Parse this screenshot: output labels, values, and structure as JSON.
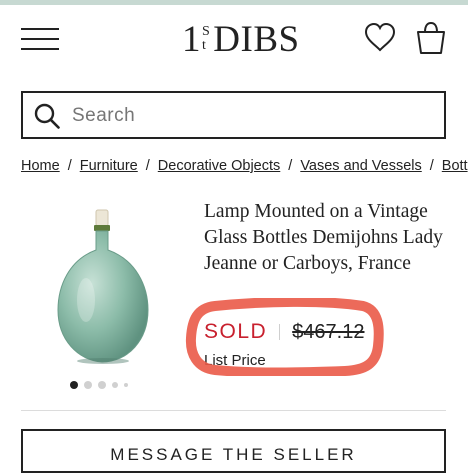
{
  "header": {
    "logo_one": "1",
    "logo_st_top": "S",
    "logo_st_bottom": "t",
    "logo_dibs": "DIBS"
  },
  "search": {
    "placeholder": "Search"
  },
  "breadcrumb": [
    "Home",
    "Furniture",
    "Decorative Objects",
    "Vases and Vessels",
    "Bott"
  ],
  "breadcrumb_separator": "/",
  "product": {
    "title": "Lamp Mounted on a Vintage Glass Bottles Demijohns Lady Jeanne or Carboys, France",
    "status": "SOLD",
    "price": "$467.12",
    "price_label": "List Price"
  },
  "gallery": {
    "image_count": 5,
    "active_index": 0
  },
  "actions": {
    "message_seller": "MESSAGE THE SELLER"
  },
  "colors": {
    "sold_red": "#c8202e",
    "highlight": "#ea5a48",
    "top_strip": "#c7d9d2",
    "glass": "#86b7a5"
  },
  "icons": [
    "menu-icon",
    "heart-icon",
    "shopping-bag-icon",
    "search-icon"
  ]
}
